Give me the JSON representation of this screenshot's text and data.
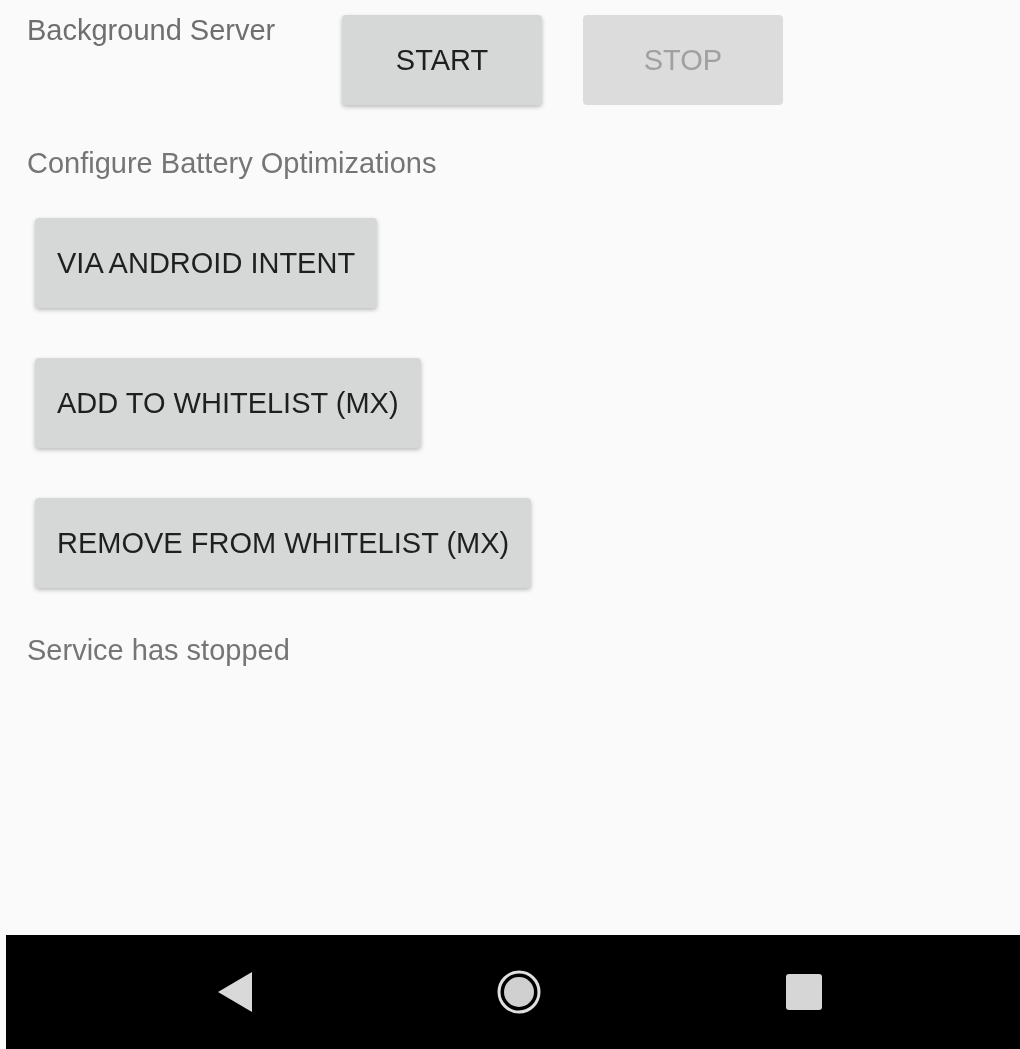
{
  "server": {
    "label": "Background Server",
    "buttons": [
      {
        "label": "START",
        "disabled": false
      },
      {
        "label": "STOP",
        "disabled": true
      }
    ]
  },
  "battery": {
    "title": "Configure Battery Optimizations",
    "buttons": [
      {
        "label": "VIA ANDROID INTENT",
        "disabled": false
      },
      {
        "label": "ADD TO WHITELIST (MX)",
        "disabled": false
      },
      {
        "label": "REMOVE FROM WHITELIST (MX)",
        "disabled": false
      }
    ]
  },
  "status": "Service has stopped"
}
